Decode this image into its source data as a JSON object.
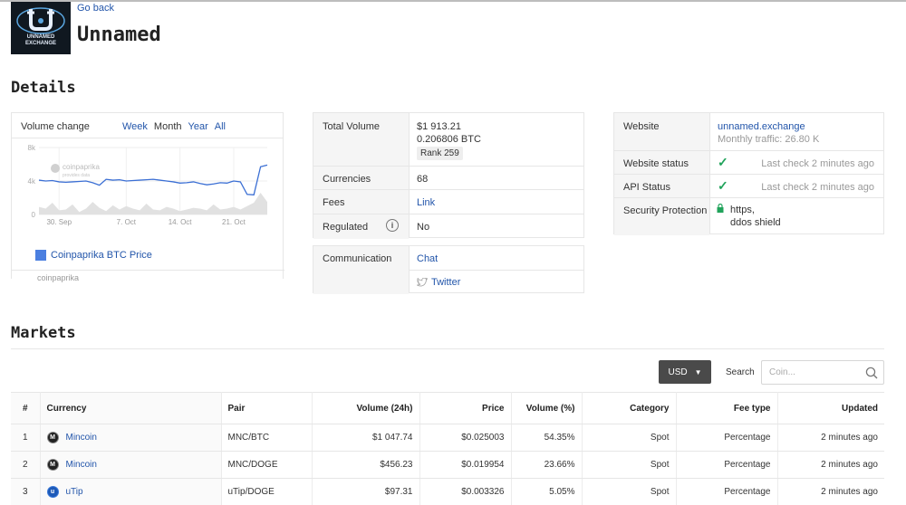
{
  "header": {
    "back_label": "Go back",
    "exchange_name": "Unnamed",
    "logo_text_line1": "UNNAMED",
    "logo_text_line2": "EXCHANGE"
  },
  "details": {
    "heading": "Details",
    "chart_card": {
      "title": "Volume change",
      "ranges": [
        "Week",
        "Month",
        "Year",
        "All"
      ],
      "active_range": "Month",
      "watermark_line1": "coinpaprika",
      "watermark_line2": "provides data",
      "legend_label": "Coinpaprika BTC Price",
      "credit": "coinpaprika"
    },
    "volume_card": {
      "total_volume_label": "Total Volume",
      "total_volume_usd": "$1 913.21",
      "total_volume_btc": "0.206806 BTC",
      "rank": "Rank 259",
      "currencies_label": "Currencies",
      "currencies_value": "68",
      "fees_label": "Fees",
      "fees_value": "Link",
      "regulated_label": "Regulated",
      "regulated_value": "No"
    },
    "communication_card": {
      "label": "Communication",
      "chat": "Chat",
      "twitter": "Twitter"
    },
    "website_card": {
      "website_label": "Website",
      "website_value": "unnamed.exchange",
      "traffic": "Monthly traffic: 26.80 K",
      "status_label": "Website status",
      "status_check": "Last check 2 minutes ago",
      "api_label": "API Status",
      "api_check": "Last check 2 minutes ago",
      "security_label": "Security Protection",
      "security_line1": "https,",
      "security_line2": "ddos shield"
    }
  },
  "chart_data": {
    "type": "line",
    "title": "Volume change",
    "y_ticks": [
      "8k",
      "4k",
      "0"
    ],
    "x_ticks": [
      "30. Sep",
      "7. Oct",
      "14. Oct",
      "21. Oct"
    ],
    "ylim": [
      0,
      8000
    ],
    "series": [
      {
        "name": "Coinpaprika BTC Price",
        "color": "#3b6fd4",
        "values": [
          4100,
          4000,
          4050,
          3900,
          3850,
          3900,
          3950,
          4000,
          3800,
          3500,
          4200,
          4100,
          4150,
          4000,
          4050,
          4100,
          4150,
          4200,
          4100,
          4000,
          3900,
          3750,
          3800,
          3900,
          3700,
          3550,
          3650,
          3800,
          3750,
          4000,
          3900,
          2400,
          2350,
          5700,
          5900
        ]
      },
      {
        "name": "Volume",
        "color": "#e1e1e1",
        "values": [
          900,
          700,
          1400,
          500,
          600,
          1200,
          300,
          700,
          1500,
          800,
          400,
          1100,
          600,
          1000,
          700,
          500,
          1300,
          600,
          500,
          900,
          700,
          400,
          600,
          800,
          700,
          500,
          1200,
          600,
          700,
          900,
          600,
          1000,
          1400,
          2600,
          1500
        ]
      }
    ]
  },
  "markets": {
    "heading": "Markets",
    "currency_selector": "USD",
    "search_label": "Search",
    "search_placeholder": "Coin...",
    "columns": [
      "#",
      "Currency",
      "Pair",
      "Volume (24h)",
      "Price",
      "Volume (%)",
      "Category",
      "Fee type",
      "Updated"
    ],
    "rows": [
      {
        "rank": "1",
        "currency": "Mincoin",
        "pair": "MNC/BTC",
        "volume": "$1 047.74",
        "price": "$0.025003",
        "share": "54.35%",
        "category": "Spot",
        "fee": "Percentage",
        "updated": "2 minutes ago"
      },
      {
        "rank": "2",
        "currency": "Mincoin",
        "pair": "MNC/DOGE",
        "volume": "$456.23",
        "price": "$0.019954",
        "share": "23.66%",
        "category": "Spot",
        "fee": "Percentage",
        "updated": "2 minutes ago"
      },
      {
        "rank": "3",
        "currency": "uTip",
        "pair": "uTip/DOGE",
        "volume": "$97.31",
        "price": "$0.003326",
        "share": "5.05%",
        "category": "Spot",
        "fee": "Percentage",
        "updated": "2 minutes ago"
      }
    ]
  },
  "colors": {
    "link": "#2255aa",
    "success": "#21a35b",
    "chart_line": "#3b6fd4",
    "dark_button": "#4a4a4a"
  }
}
